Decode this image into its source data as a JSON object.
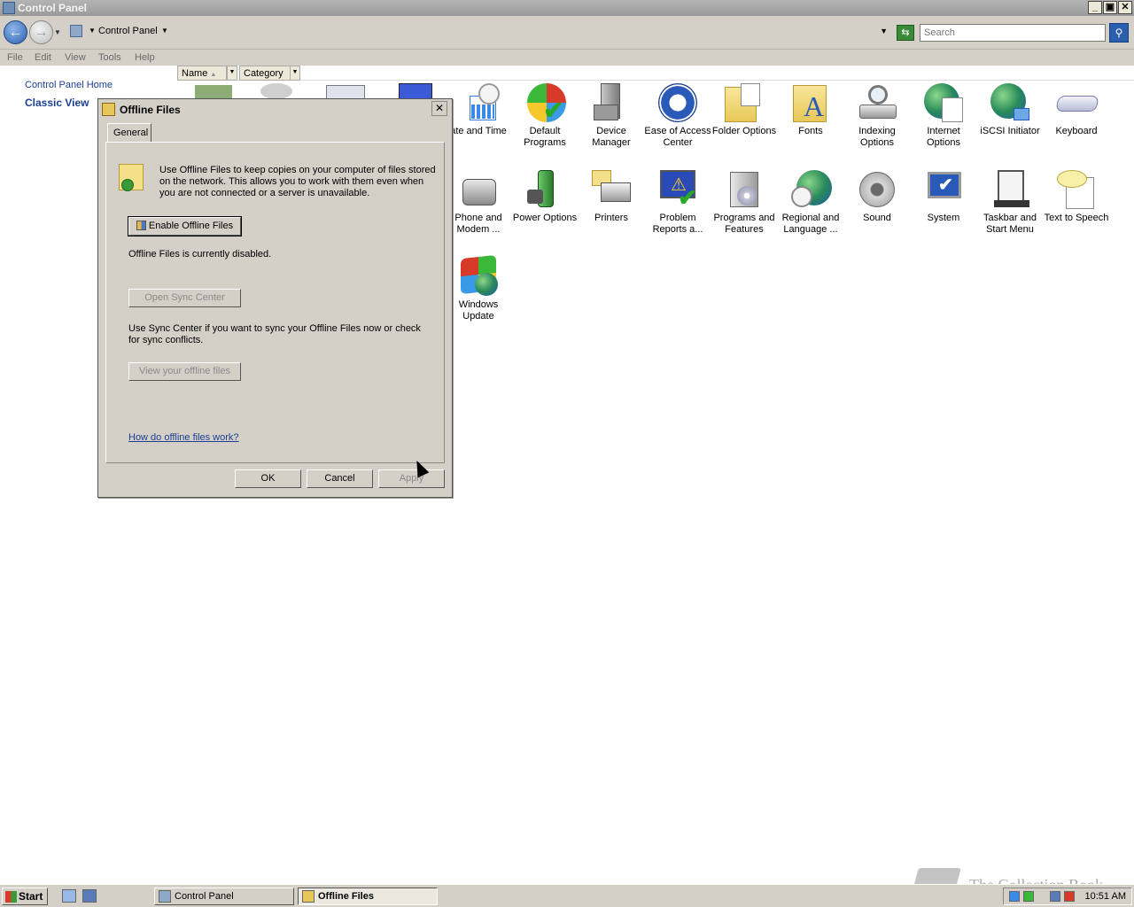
{
  "window": {
    "title": "Control Panel"
  },
  "address": {
    "breadcrumb": "Control Panel",
    "search_placeholder": "Search"
  },
  "menu": [
    "File",
    "Edit",
    "View",
    "Tools",
    "Help"
  ],
  "columns": {
    "name": "Name",
    "category": "Category"
  },
  "leftpane": {
    "home": "Control Panel Home",
    "classic": "Classic View"
  },
  "items": [
    {
      "label": "ate and Time",
      "icon": "calendar-clock-icon"
    },
    {
      "label": "Default Programs",
      "icon": "default-programs-icon"
    },
    {
      "label": "Device Manager",
      "icon": "device-manager-icon"
    },
    {
      "label": "Ease of Access Center",
      "icon": "ease-of-access-icon"
    },
    {
      "label": "Folder Options",
      "icon": "folder-options-icon"
    },
    {
      "label": "Fonts",
      "icon": "fonts-icon"
    },
    {
      "label": "Indexing Options",
      "icon": "indexing-icon"
    },
    {
      "label": "Internet Options",
      "icon": "internet-options-icon"
    },
    {
      "label": "iSCSI Initiator",
      "icon": "iscsi-icon"
    },
    {
      "label": "Keyboard",
      "icon": "keyboard-icon"
    },
    {
      "label": "Phone and Modem ...",
      "icon": "phone-modem-icon"
    },
    {
      "label": "Power Options",
      "icon": "power-options-icon"
    },
    {
      "label": "Printers",
      "icon": "printers-icon"
    },
    {
      "label": "Problem Reports a...",
      "icon": "problem-reports-icon"
    },
    {
      "label": "Programs and Features",
      "icon": "programs-features-icon"
    },
    {
      "label": "Regional and Language ...",
      "icon": "regional-icon"
    },
    {
      "label": "Sound",
      "icon": "sound-icon"
    },
    {
      "label": "System",
      "icon": "system-icon"
    },
    {
      "label": "Taskbar and Start Menu",
      "icon": "taskbar-icon"
    },
    {
      "label": "Text to Speech",
      "icon": "text-to-speech-icon"
    },
    {
      "label": "Windows Update",
      "icon": "windows-update-icon"
    }
  ],
  "dialog": {
    "title": "Offline Files",
    "tab": "General",
    "description": "Use Offline Files to keep copies on your computer of files stored on the network.  This allows you to work with them even when you are not connected or a server is unavailable.",
    "enable_button": "Enable Offline Files",
    "status": "Offline Files is currently disabled.",
    "sync_button": "Open Sync Center",
    "sync_description": "Use Sync Center if you want to sync your Offline Files now or check for sync conflicts.",
    "view_button": "View your offline files",
    "help_link": "How do offline files work?",
    "ok": "OK",
    "cancel": "Cancel",
    "apply": "Apply"
  },
  "taskbar": {
    "start": "Start",
    "tasks": [
      "Control Panel",
      "Offline Files"
    ],
    "clock": "10:51 AM"
  },
  "watermark": "The Collection Book"
}
